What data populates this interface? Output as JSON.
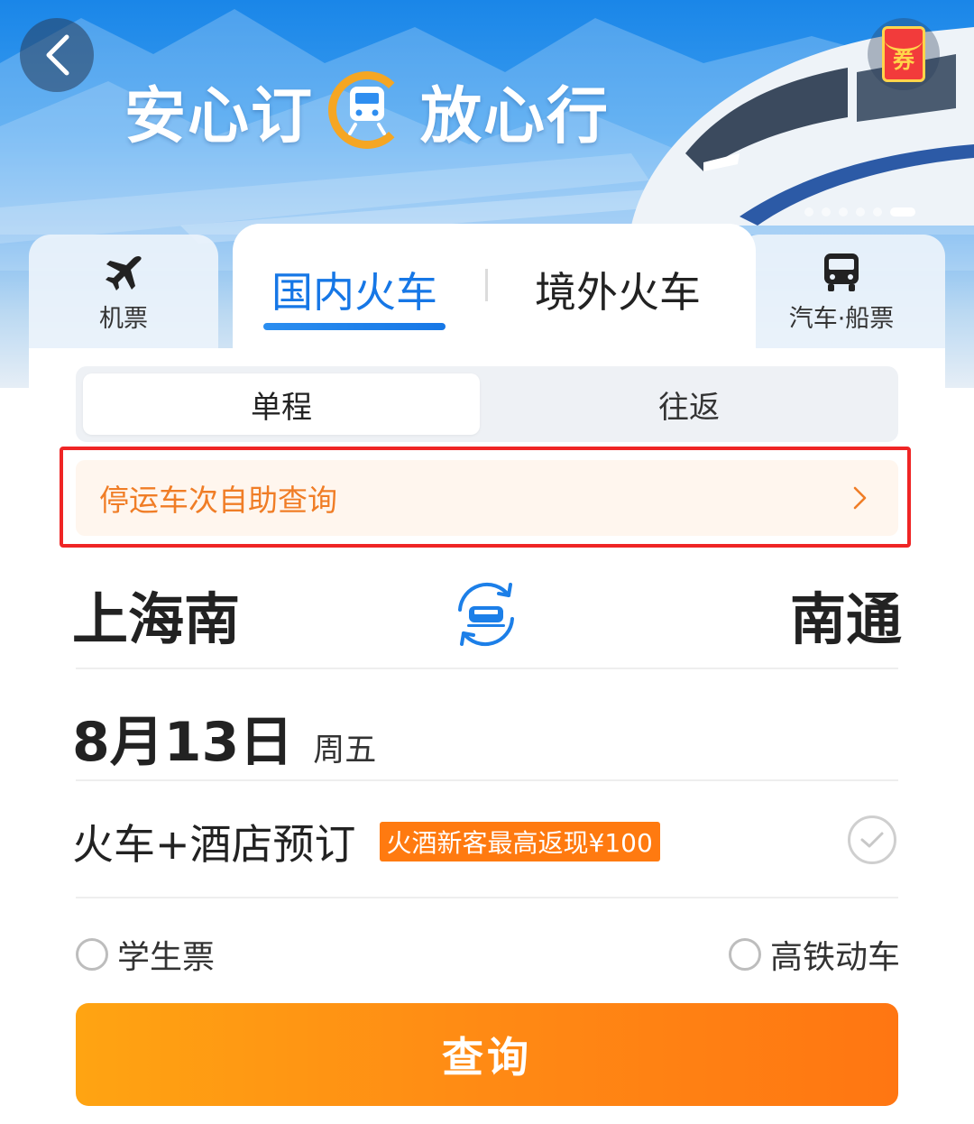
{
  "header": {
    "slogan_left": "安心订",
    "slogan_right": "放心行",
    "coupon_label": "券",
    "banner_slide_count": 6,
    "banner_active_slide": 6
  },
  "tabs": {
    "flight": "机票",
    "domestic_train": "国内火车",
    "overseas_train": "境外火车",
    "bus_ship": "汽车·船票",
    "active": "国内火车"
  },
  "trip_type": {
    "one_way": "单程",
    "round_trip": "往返",
    "selected": "单程"
  },
  "notice": {
    "text": "停运车次自助查询"
  },
  "route": {
    "from": "上海南",
    "to": "南通"
  },
  "date": {
    "day": "8月13日",
    "weekday": "周五"
  },
  "combo": {
    "label": "火车+酒店预订",
    "badge": "火酒新客最高返现¥100",
    "checked": false
  },
  "options": {
    "student": "学生票",
    "high_speed": "高铁动车"
  },
  "search": {
    "label": "查询"
  },
  "colors": {
    "brand_blue": "#1677e6",
    "accent_orange": "#ff8a14",
    "notice_text": "#f07d26",
    "highlight_red": "#ef2525"
  }
}
